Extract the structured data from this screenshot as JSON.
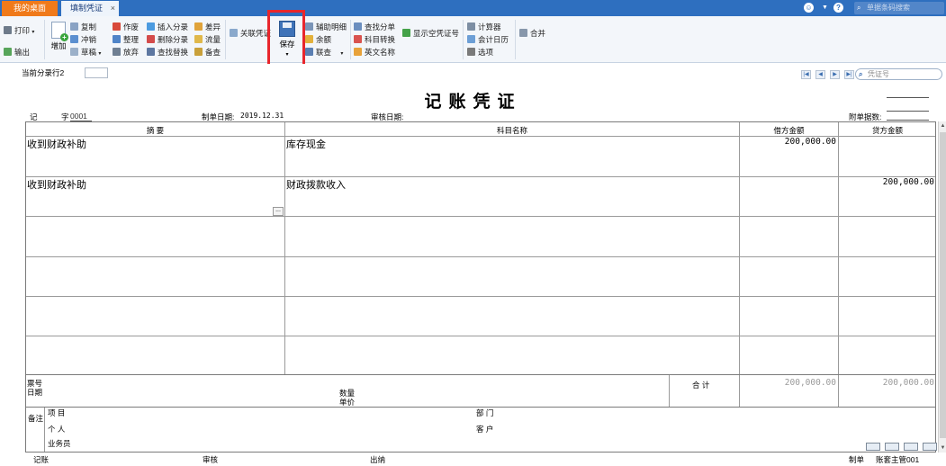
{
  "tabs": {
    "home": "我的桌面",
    "voucher": "填制凭证",
    "close": "×"
  },
  "top_right": {
    "search_placeholder": "单据条码搜索"
  },
  "toolbar": {
    "print": "打印",
    "export": "输出",
    "add": "增加",
    "copy": "复制",
    "reverse": "冲销",
    "draft": "草稿",
    "void": "作废",
    "organize": "整理",
    "abandon": "放弃",
    "insert_entry": "插入分录",
    "delete_entry": "删除分录",
    "find_replace": "查找替换",
    "difference": "差异",
    "cash_flow": "流量",
    "memo": "备查",
    "linked_voucher": "关联凭证",
    "save": "保存",
    "aux_detail": "辅助明细",
    "balance": "余额",
    "link_query": "联查",
    "find_entry": "查找分单",
    "account_convert": "科目转换",
    "english_name": "英文名称",
    "show_empty_no": "显示空凭证号",
    "calculator": "计算器",
    "accounting_calendar": "会计日历",
    "options": "选项",
    "merge": "合并"
  },
  "subbar": {
    "current_row_label": "当前分录行2",
    "voucher_search_placeholder": "凭证号"
  },
  "voucher": {
    "title": "记账凭证",
    "type_label": "记",
    "no_label": "字",
    "no_value": "0001",
    "date_label": "制单日期:",
    "date_value": "2019.12.31",
    "audit_label": "审核日期:",
    "attach_label": "附单据数:",
    "columns": {
      "summary": "摘 要",
      "account": "科目名称",
      "debit": "借方金额",
      "credit": "贷方金额"
    },
    "rows": [
      {
        "summary": "收到财政补助",
        "account": "库存现金",
        "debit": "200,000.00",
        "credit": ""
      },
      {
        "summary": "收到财政补助",
        "account": "财政拨款收入",
        "debit": "",
        "credit": "200,000.00"
      }
    ],
    "totals": {
      "ticket_no": "票号",
      "date": "日期",
      "quantity": "数量",
      "unit_price": "单价",
      "total_label": "合 计",
      "debit_total": "200,000.00",
      "credit_total": "200,000.00"
    },
    "remarks": {
      "label": "备注",
      "project": "项 目",
      "department": "部 门",
      "person": "个 人",
      "customer": "客 户",
      "salesperson": "业务员"
    },
    "footer": {
      "bookkeeping": "记账",
      "audit": "审核",
      "cashier": "出纳",
      "maker": "制单",
      "maker_name": "账套主管001"
    }
  }
}
